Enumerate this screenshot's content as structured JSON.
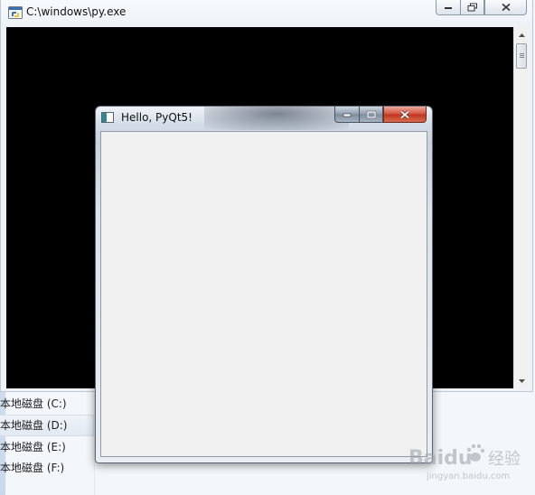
{
  "explorer": {
    "drives": [
      {
        "label": "本地磁盘 (C:)",
        "selected": false
      },
      {
        "label": "本地磁盘 (D:)",
        "selected": true
      },
      {
        "label": "本地磁盘 (E:)",
        "selected": false
      },
      {
        "label": "本地磁盘 (F:)",
        "selected": false
      }
    ]
  },
  "console_window": {
    "title": "C:\\windows\\py.exe",
    "client_color": "#000000"
  },
  "pyqt_window": {
    "title": "Hello, PyQt5!",
    "client_color": "#f0f0f0"
  },
  "watermark": {
    "brand": "Baidu",
    "chinese": "经验",
    "url": "jingyan.baidu.com"
  },
  "icons": [
    "python-icon",
    "minimize-icon",
    "maximize-icon",
    "close-icon",
    "scroll-up-icon",
    "scroll-down-icon",
    "qt-window-icon",
    "paw-icon"
  ]
}
